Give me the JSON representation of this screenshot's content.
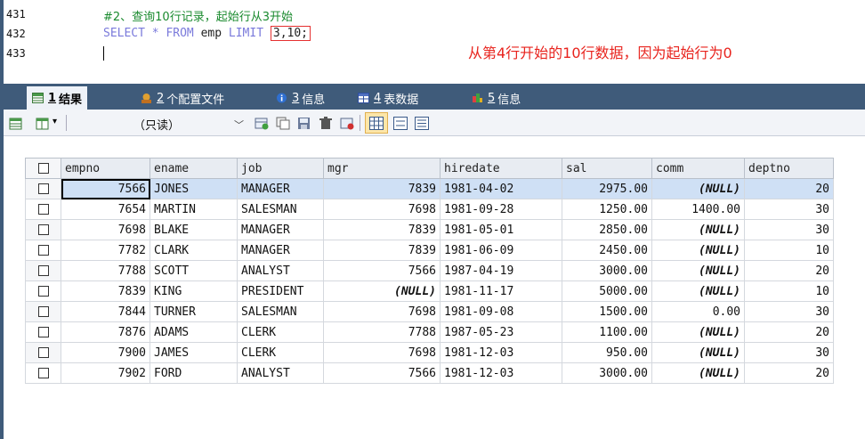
{
  "editor": {
    "lines": [
      {
        "num": "431",
        "comment": "#2、查询10行记录，起始行从3开始"
      },
      {
        "num": "432",
        "kw1": "SELECT",
        "star": " * ",
        "kw2": "FROM",
        "table": " emp ",
        "kw3": "LIMIT",
        "limit": "3,10;"
      },
      {
        "num": "433"
      }
    ],
    "annotation": "从第4行开始的10行数据，因为起始行为0"
  },
  "tabs": [
    {
      "num": "1",
      "label": "结果",
      "active": true
    },
    {
      "num": "2",
      "label": "个配置文件"
    },
    {
      "num": "3",
      "label": "信息"
    },
    {
      "num": "4",
      "label": "表数据"
    },
    {
      "num": "5",
      "label": "信息"
    }
  ],
  "toolbar": {
    "readonly_label": "（只读）"
  },
  "grid": {
    "columns": [
      "empno",
      "ename",
      "job",
      "mgr",
      "hiredate",
      "sal",
      "comm",
      "deptno"
    ],
    "rows": [
      [
        "7566",
        "JONES",
        "MANAGER",
        "7839",
        "1981-04-02",
        "2975.00",
        "(NULL)",
        "20"
      ],
      [
        "7654",
        "MARTIN",
        "SALESMAN",
        "7698",
        "1981-09-28",
        "1250.00",
        "1400.00",
        "30"
      ],
      [
        "7698",
        "BLAKE",
        "MANAGER",
        "7839",
        "1981-05-01",
        "2850.00",
        "(NULL)",
        "30"
      ],
      [
        "7782",
        "CLARK",
        "MANAGER",
        "7839",
        "1981-06-09",
        "2450.00",
        "(NULL)",
        "10"
      ],
      [
        "7788",
        "SCOTT",
        "ANALYST",
        "7566",
        "1987-04-19",
        "3000.00",
        "(NULL)",
        "20"
      ],
      [
        "7839",
        "KING",
        "PRESIDENT",
        "(NULL)",
        "1981-11-17",
        "5000.00",
        "(NULL)",
        "10"
      ],
      [
        "7844",
        "TURNER",
        "SALESMAN",
        "7698",
        "1981-09-08",
        "1500.00",
        "0.00",
        "30"
      ],
      [
        "7876",
        "ADAMS",
        "CLERK",
        "7788",
        "1987-05-23",
        "1100.00",
        "(NULL)",
        "20"
      ],
      [
        "7900",
        "JAMES",
        "CLERK",
        "7698",
        "1981-12-03",
        "950.00",
        "(NULL)",
        "30"
      ],
      [
        "7902",
        "FORD",
        "ANALYST",
        "7566",
        "1981-12-03",
        "3000.00",
        "(NULL)",
        "20"
      ]
    ]
  },
  "colors": {
    "accent": "#3f5b7a",
    "annotation": "#e8231d",
    "highlight_box": "#e53030"
  }
}
